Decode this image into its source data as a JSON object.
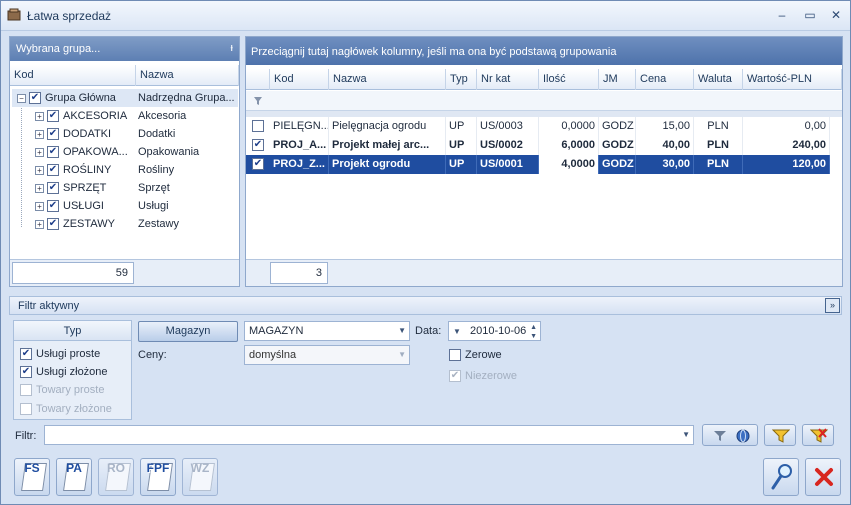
{
  "window": {
    "title": "Łatwa sprzedaż",
    "minimize": "‒",
    "maximize": "▭",
    "close": "✕"
  },
  "left_panel": {
    "header": "Wybrana grupa...",
    "pin": "ᵻ",
    "columns": [
      "Kod",
      "Nazwa"
    ],
    "tree": [
      {
        "kod": "Grupa Główna",
        "nazwa": "Nadrzędna Grupa..."
      },
      {
        "kod": "AKCESORIA",
        "nazwa": "Akcesoria"
      },
      {
        "kod": "DODATKI",
        "nazwa": "Dodatki"
      },
      {
        "kod": "OPAKOWA...",
        "nazwa": "Opakowania"
      },
      {
        "kod": "ROŚLINY",
        "nazwa": "Rośliny"
      },
      {
        "kod": "SPRZĘT",
        "nazwa": "Sprzęt"
      },
      {
        "kod": "USŁUGI",
        "nazwa": "Usługi"
      },
      {
        "kod": "ZESTAWY",
        "nazwa": "Zestawy"
      }
    ],
    "count": "59"
  },
  "main_grid": {
    "group_hint": "Przeciągnij tutaj nagłówek kolumny, jeśli ma ona być podstawą grupowania",
    "columns": [
      "Kod",
      "Nazwa",
      "Typ",
      "Nr kat",
      "Ilość",
      "JM",
      "Cena",
      "Waluta",
      "Wartość-PLN"
    ],
    "rows": [
      {
        "checked": false,
        "kod": "PIELĘGN...",
        "nazwa": "Pielęgnacja ogrodu",
        "typ": "UP",
        "nrkat": "US/0003",
        "ilosc": "0,0000",
        "jm": "GODZ",
        "cena": "15,00",
        "waluta": "PLN",
        "wartosc": "0,00"
      },
      {
        "checked": true,
        "kod": "PROJ_A...",
        "nazwa": "Projekt małej arc...",
        "typ": "UP",
        "nrkat": "US/0002",
        "ilosc": "6,0000",
        "jm": "GODZ",
        "cena": "40,00",
        "waluta": "PLN",
        "wartosc": "240,00"
      },
      {
        "checked": true,
        "kod": "PROJ_Z...",
        "nazwa": "Projekt ogrodu",
        "typ": "UP",
        "nrkat": "US/0001",
        "ilosc": "4,0000",
        "jm": "GODZ",
        "cena": "30,00",
        "waluta": "PLN",
        "wartosc": "120,00"
      }
    ],
    "count": "3"
  },
  "filter": {
    "bar_label": "Filtr aktywny",
    "collapse": "»",
    "typ_title": "Typ",
    "typ_options": [
      {
        "label": "Usługi proste",
        "checked": true,
        "disabled": false
      },
      {
        "label": "Usługi złożone",
        "checked": true,
        "disabled": false
      },
      {
        "label": "Towary proste",
        "checked": false,
        "disabled": true
      },
      {
        "label": "Towary złożone",
        "checked": false,
        "disabled": true
      }
    ],
    "magazyn_button": "Magazyn",
    "magazyn_value": "MAGAZYN",
    "ceny_label": "Ceny:",
    "ceny_value": "domyślna",
    "data_label": "Data:",
    "data_value": "2010-10-06",
    "zerowe_label": "Zerowe",
    "niezerowe_label": "Niezerowe",
    "filtr_label": "Filtr:",
    "filtr_value": ""
  },
  "toolbar": {
    "fs": "FS",
    "pa": "PA",
    "ro": "RO",
    "fpf": "FPF",
    "wz": "WZ"
  }
}
